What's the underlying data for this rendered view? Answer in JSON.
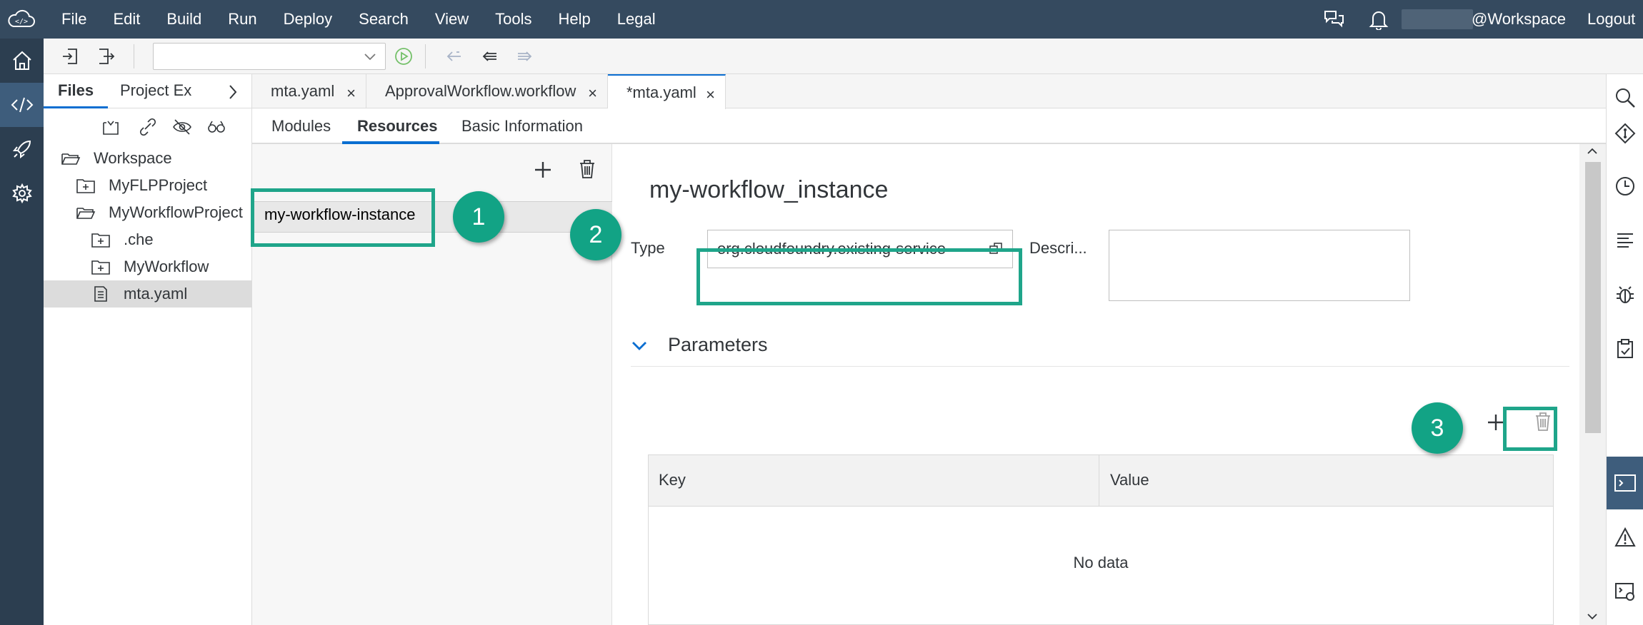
{
  "menubar": {
    "items": [
      "File",
      "Edit",
      "Build",
      "Run",
      "Deploy",
      "Search",
      "View",
      "Tools",
      "Help",
      "Legal"
    ],
    "user": "@Workspace",
    "logout": "Logout"
  },
  "file_panel": {
    "tab_files": "Files",
    "tab_explorer": "Project Explorer",
    "tree": [
      {
        "label": "Workspace",
        "icon": "folder-open-icon"
      },
      {
        "label": "MyFLPProject",
        "icon": "folder-closed-icon"
      },
      {
        "label": "MyWorkflowProject",
        "icon": "folder-open-icon"
      },
      {
        "label": ".che",
        "icon": "folder-closed-icon"
      },
      {
        "label": "MyWorkflow",
        "icon": "folder-closed-icon"
      },
      {
        "label": "mta.yaml",
        "icon": "file-icon",
        "selected": true
      }
    ]
  },
  "editor": {
    "tabs": [
      {
        "label": "mta.yaml"
      },
      {
        "label": "ApprovalWorkflow.workflow"
      },
      {
        "label": "*mta.yaml",
        "active": true
      }
    ],
    "close_glyph": "×",
    "subtabs": [
      "Modules",
      "Resources",
      "Basic Information"
    ],
    "active_subtab": "Resources"
  },
  "resources": {
    "items": [
      "my-workflow-instance"
    ],
    "detail": {
      "title": "my-workflow_instance",
      "type_label": "Type",
      "type_value": "org.cloudfoundry.existing-service",
      "description_label": "Descri...",
      "description_value": "",
      "parameters_title": "Parameters",
      "table": {
        "columns": [
          "Key",
          "Value"
        ],
        "empty_text": "No data"
      }
    }
  },
  "callouts": [
    "1",
    "2",
    "3"
  ],
  "colors": {
    "header_bg": "#354a5f",
    "sidebar_bg": "#2c3e50",
    "active_accent": "#0a6ed1",
    "callout_green": "#12a385",
    "highlight_border": "#1fa58a"
  }
}
